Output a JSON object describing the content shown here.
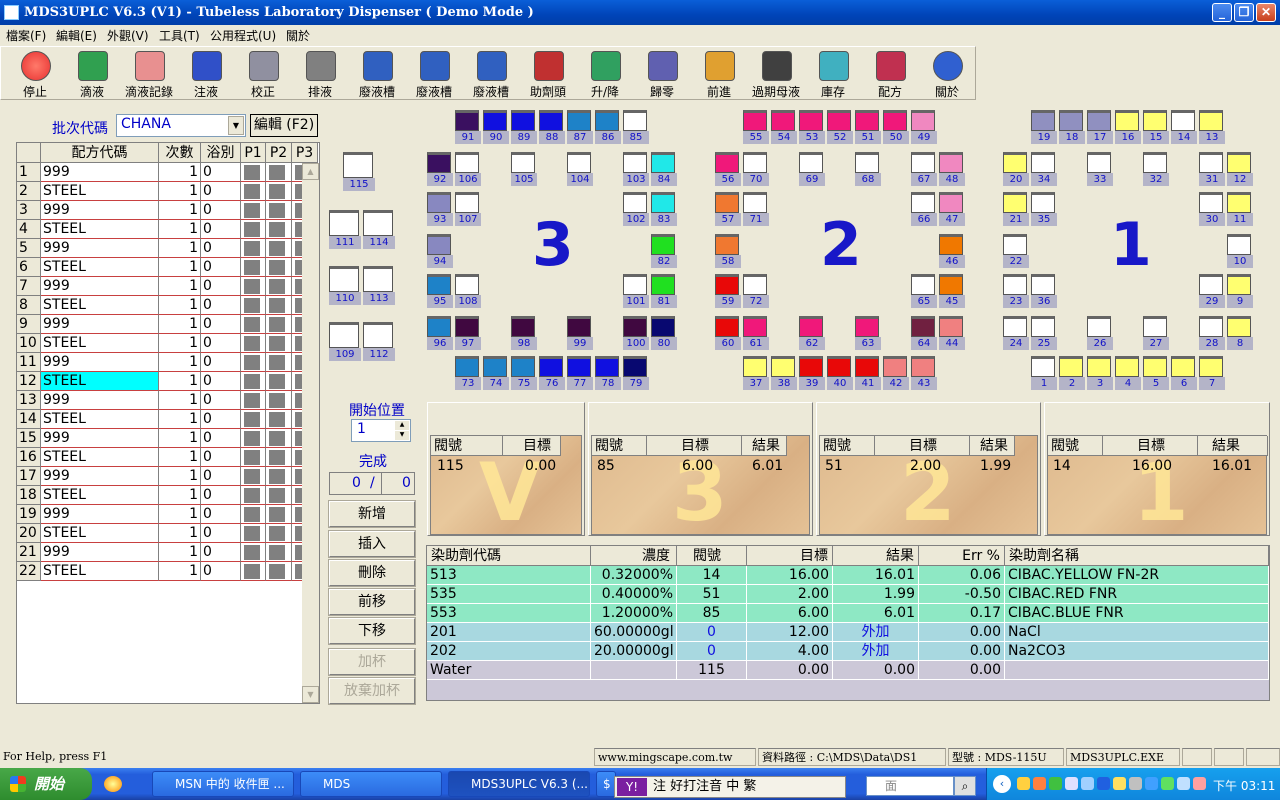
{
  "window": {
    "title": "MDS3UPLC V6.3 (V1) - Tubeless Laboratory Dispenser ( Demo Mode )"
  },
  "menu": [
    "檔案(F)",
    "編輯(E)",
    "外觀(V)",
    "工具(T)",
    "公用程式(U)",
    "關於"
  ],
  "toolbar": [
    {
      "label": "停止",
      "icon": "stop-icon",
      "color": "#e83030"
    },
    {
      "label": "滴液",
      "icon": "drip-icon",
      "color": "#30a050"
    },
    {
      "label": "滴液記錄",
      "icon": "record-icon",
      "color": "#e89090"
    },
    {
      "label": "注液",
      "icon": "inject-icon",
      "color": "#3050c8"
    },
    {
      "label": "校正",
      "icon": "calibrate-icon",
      "color": "#9090a0"
    },
    {
      "label": "排液",
      "icon": "drain-icon",
      "color": "#808080"
    },
    {
      "label": "廢液槽",
      "icon": "waste1-icon",
      "color": "#3060c0"
    },
    {
      "label": "廢液槽",
      "icon": "waste2-icon",
      "color": "#3060c0"
    },
    {
      "label": "廢液槽",
      "icon": "waste3-icon",
      "color": "#3060c0"
    },
    {
      "label": "助劑頭",
      "icon": "aux-head-icon",
      "color": "#c03030"
    },
    {
      "label": "升/降",
      "icon": "lift-icon",
      "color": "#30a060"
    },
    {
      "label": "歸零",
      "icon": "zero-icon",
      "color": "#6060b0"
    },
    {
      "label": "前進",
      "icon": "forward-icon",
      "color": "#e0a030"
    },
    {
      "label": "過期母液",
      "icon": "clock-icon",
      "color": "#404040"
    },
    {
      "label": "庫存",
      "icon": "stock-icon",
      "color": "#40b0c0"
    },
    {
      "label": "配方",
      "icon": "recipe-icon",
      "color": "#c03050"
    },
    {
      "label": "關於",
      "icon": "help-icon",
      "color": "#3060d0"
    }
  ],
  "batch": {
    "label": "批次代碼",
    "value": "CHANA",
    "edit_label": "編輯 (F2)"
  },
  "grid": {
    "headers": [
      "配方代碼",
      "次數",
      "浴別",
      "P1",
      "P2",
      "P3"
    ],
    "rows": [
      {
        "n": "1",
        "code": "999",
        "count": "1",
        "bath": "0"
      },
      {
        "n": "2",
        "code": "STEEL",
        "count": "1",
        "bath": "0"
      },
      {
        "n": "3",
        "code": "999",
        "count": "1",
        "bath": "0"
      },
      {
        "n": "4",
        "code": "STEEL",
        "count": "1",
        "bath": "0"
      },
      {
        "n": "5",
        "code": "999",
        "count": "1",
        "bath": "0"
      },
      {
        "n": "6",
        "code": "STEEL",
        "count": "1",
        "bath": "0"
      },
      {
        "n": "7",
        "code": "999",
        "count": "1",
        "bath": "0"
      },
      {
        "n": "8",
        "code": "STEEL",
        "count": "1",
        "bath": "0"
      },
      {
        "n": "9",
        "code": "999",
        "count": "1",
        "bath": "0"
      },
      {
        "n": "10",
        "code": "STEEL",
        "count": "1",
        "bath": "0"
      },
      {
        "n": "11",
        "code": "999",
        "count": "1",
        "bath": "0"
      },
      {
        "n": "12",
        "code": "STEEL",
        "count": "1",
        "bath": "0",
        "selected": true
      },
      {
        "n": "13",
        "code": "999",
        "count": "1",
        "bath": "0"
      },
      {
        "n": "14",
        "code": "STEEL",
        "count": "1",
        "bath": "0"
      },
      {
        "n": "15",
        "code": "999",
        "count": "1",
        "bath": "0"
      },
      {
        "n": "16",
        "code": "STEEL",
        "count": "1",
        "bath": "0"
      },
      {
        "n": "17",
        "code": "999",
        "count": "1",
        "bath": "0"
      },
      {
        "n": "18",
        "code": "STEEL",
        "count": "1",
        "bath": "0"
      },
      {
        "n": "19",
        "code": "999",
        "count": "1",
        "bath": "0"
      },
      {
        "n": "20",
        "code": "STEEL",
        "count": "1",
        "bath": "0"
      },
      {
        "n": "21",
        "code": "999",
        "count": "1",
        "bath": "0"
      },
      {
        "n": "22",
        "code": "STEEL",
        "count": "1",
        "bath": "0"
      }
    ]
  },
  "stations": {
    "s3": "3",
    "s2": "2",
    "s1": "1"
  },
  "small_cups": [
    "115",
    "111",
    "114",
    "110",
    "113",
    "109",
    "112"
  ],
  "cups3": [
    [
      "91",
      "#3a1060"
    ],
    [
      "90",
      "#1010e0"
    ],
    [
      "89",
      "#1010e0"
    ],
    [
      "88",
      "#1010e0"
    ],
    [
      "87",
      "#1e82c8"
    ],
    [
      "86",
      "#1e82c8"
    ],
    [
      "85",
      "#ffffff"
    ],
    [
      "92",
      "#3a1060"
    ],
    [
      "106",
      "#ffffff"
    ],
    [
      "105",
      "#ffffff"
    ],
    [
      "104",
      "#ffffff"
    ],
    [
      "103",
      "#ffffff"
    ],
    [
      "84",
      "#20e8e8"
    ],
    [
      "93",
      "#8888c0"
    ],
    [
      "107",
      "#ffffff"
    ],
    [
      "102",
      "#ffffff"
    ],
    [
      "83",
      "#20e8e8"
    ],
    [
      "94",
      "#8888c0"
    ],
    [
      "82",
      "#20e020"
    ],
    [
      "95",
      "#1e82c8"
    ],
    [
      "108",
      "#ffffff"
    ],
    [
      "101",
      "#ffffff"
    ],
    [
      "81",
      "#20e020"
    ],
    [
      "96",
      "#1e82c8"
    ],
    [
      "97",
      "#400840"
    ],
    [
      "98",
      "#400840"
    ],
    [
      "99",
      "#400840"
    ],
    [
      "100",
      "#400840"
    ],
    [
      "80",
      "#080870"
    ],
    [
      "73",
      "#1e82c8"
    ],
    [
      "74",
      "#1e82c8"
    ],
    [
      "75",
      "#1e82c8"
    ],
    [
      "76",
      "#1010e0"
    ],
    [
      "77",
      "#1010e0"
    ],
    [
      "78",
      "#1010e0"
    ],
    [
      "79",
      "#080870"
    ]
  ],
  "cups2": [
    [
      "55",
      "#f0187a"
    ],
    [
      "54",
      "#f0187a"
    ],
    [
      "53",
      "#f0187a"
    ],
    [
      "52",
      "#f0187a"
    ],
    [
      "51",
      "#f0187a"
    ],
    [
      "50",
      "#f0187a"
    ],
    [
      "49",
      "#f088c0"
    ],
    [
      "56",
      "#f0187a"
    ],
    [
      "70",
      "#ffffff"
    ],
    [
      "69",
      "#ffffff"
    ],
    [
      "68",
      "#ffffff"
    ],
    [
      "67",
      "#ffffff"
    ],
    [
      "48",
      "#f088c0"
    ],
    [
      "57",
      "#f07830"
    ],
    [
      "71",
      "#ffffff"
    ],
    [
      "66",
      "#ffffff"
    ],
    [
      "47",
      "#f088c0"
    ],
    [
      "58",
      "#f07830"
    ],
    [
      "46",
      "#f07800"
    ],
    [
      "59",
      "#e80808"
    ],
    [
      "72",
      "#ffffff"
    ],
    [
      "65",
      "#ffffff"
    ],
    [
      "45",
      "#f07800"
    ],
    [
      "60",
      "#e80808"
    ],
    [
      "61",
      "#f0187a"
    ],
    [
      "62",
      "#f0187a"
    ],
    [
      "63",
      "#f0187a"
    ],
    [
      "64",
      "#702040"
    ],
    [
      "44",
      "#f08080"
    ],
    [
      "37",
      "#ffff70"
    ],
    [
      "38",
      "#ffff70"
    ],
    [
      "39",
      "#e80808"
    ],
    [
      "40",
      "#e80808"
    ],
    [
      "41",
      "#e80808"
    ],
    [
      "42",
      "#f08080"
    ],
    [
      "43",
      "#f08080"
    ]
  ],
  "cups1": [
    [
      "19",
      "#9090c0"
    ],
    [
      "18",
      "#9090c0"
    ],
    [
      "17",
      "#9090c0"
    ],
    [
      "16",
      "#ffff70"
    ],
    [
      "15",
      "#ffff70"
    ],
    [
      "14",
      "#ffffff"
    ],
    [
      "13",
      "#ffff70"
    ],
    [
      "20",
      "#ffff70"
    ],
    [
      "34",
      "#ffffff"
    ],
    [
      "33",
      "#ffffff"
    ],
    [
      "32",
      "#ffffff"
    ],
    [
      "31",
      "#ffffff"
    ],
    [
      "12",
      "#ffff70"
    ],
    [
      "21",
      "#ffff70"
    ],
    [
      "35",
      "#ffffff"
    ],
    [
      "30",
      "#ffffff"
    ],
    [
      "11",
      "#ffff70"
    ],
    [
      "22",
      "#ffffff"
    ],
    [
      "10",
      "#ffffff"
    ],
    [
      "23",
      "#ffffff"
    ],
    [
      "36",
      "#ffffff"
    ],
    [
      "29",
      "#ffffff"
    ],
    [
      "9",
      "#ffff70"
    ],
    [
      "24",
      "#ffffff"
    ],
    [
      "25",
      "#ffffff"
    ],
    [
      "26",
      "#ffffff"
    ],
    [
      "27",
      "#ffffff"
    ],
    [
      "28",
      "#ffffff"
    ],
    [
      "8",
      "#ffff70"
    ],
    [
      "1",
      "#ffffff"
    ],
    [
      "2",
      "#ffff70"
    ],
    [
      "3",
      "#ffff70"
    ],
    [
      "4",
      "#ffff70"
    ],
    [
      "5",
      "#ffff70"
    ],
    [
      "6",
      "#ffff70"
    ],
    [
      "7",
      "#ffff70"
    ]
  ],
  "controls": {
    "start_pos_label": "開始位置",
    "start_pos": "1",
    "done_label": "完成",
    "done_a": "0",
    "done_sep": "/",
    "done_b": "0",
    "buttons": [
      "新增",
      "插入",
      "刪除",
      "前移",
      "下移",
      "加杯",
      "放棄加杯"
    ]
  },
  "panels": [
    {
      "h_valve": "閥號",
      "h_target": "目標",
      "valve": "115",
      "target": "0.00",
      "mark": "V"
    },
    {
      "h_valve": "閥號",
      "h_target": "目標",
      "h_result": "結果",
      "valve": "85",
      "target": "6.00",
      "result": "6.01",
      "mark": "3"
    },
    {
      "h_valve": "閥號",
      "h_target": "目標",
      "h_result": "結果",
      "valve": "51",
      "target": "2.00",
      "result": "1.99",
      "mark": "2"
    },
    {
      "h_valve": "閥號",
      "h_target": "目標",
      "h_result": "結果",
      "valve": "14",
      "target": "16.00",
      "result": "16.01",
      "mark": "1"
    }
  ],
  "table": {
    "headers": [
      "染助劑代碼",
      "濃度",
      "閥號",
      "目標",
      "結果",
      "Err %",
      "染助劑名稱"
    ],
    "rows": [
      {
        "code": "513",
        "conc": "0.32000%",
        "valve": "14",
        "target": "16.00",
        "result": "16.01",
        "err": "0.06",
        "name": "CIBAC.YELLOW FN-2R",
        "bg": "#8ee8c4"
      },
      {
        "code": "535",
        "conc": "0.40000%",
        "valve": "51",
        "target": "2.00",
        "result": "1.99",
        "err": "-0.50",
        "name": "CIBAC.RED FNR",
        "bg": "#8ee8c4"
      },
      {
        "code": "553",
        "conc": "1.20000%",
        "valve": "85",
        "target": "6.00",
        "result": "6.01",
        "err": "0.17",
        "name": "CIBAC.BLUE FNR",
        "bg": "#8ee8c4"
      },
      {
        "code": "201",
        "conc": "60.00000gl",
        "valve": "0",
        "target": "12.00",
        "result": "外加",
        "err": "0.00",
        "name": "NaCl",
        "bg": "#a8d8e0",
        "blue": true
      },
      {
        "code": "202",
        "conc": "20.00000gl",
        "valve": "0",
        "target": "4.00",
        "result": "外加",
        "err": "0.00",
        "name": "Na2CO3",
        "bg": "#a8d8e0",
        "blue": true
      },
      {
        "code": "Water",
        "conc": "",
        "valve": "115",
        "target": "0.00",
        "result": "0.00",
        "err": "0.00",
        "name": "",
        "bg": "#ccc8d8"
      }
    ]
  },
  "status": {
    "help": "For Help, press F1",
    "url": "www.mingscape.com.tw",
    "path": "資料路徑 : C:\\MDS\\Data\\DS1",
    "model": "型號 : MDS-115U",
    "exe": "MDS3UPLC.EXE"
  },
  "taskbar": {
    "start": "開始",
    "tasks": [
      "MSN 中的 收件匣 ...",
      "MDS",
      "MDS3UPLC V6.3 (...",
      "$"
    ],
    "ime": "注 好打注音  中  繁",
    "search": "面",
    "time": "下午 03:11"
  }
}
